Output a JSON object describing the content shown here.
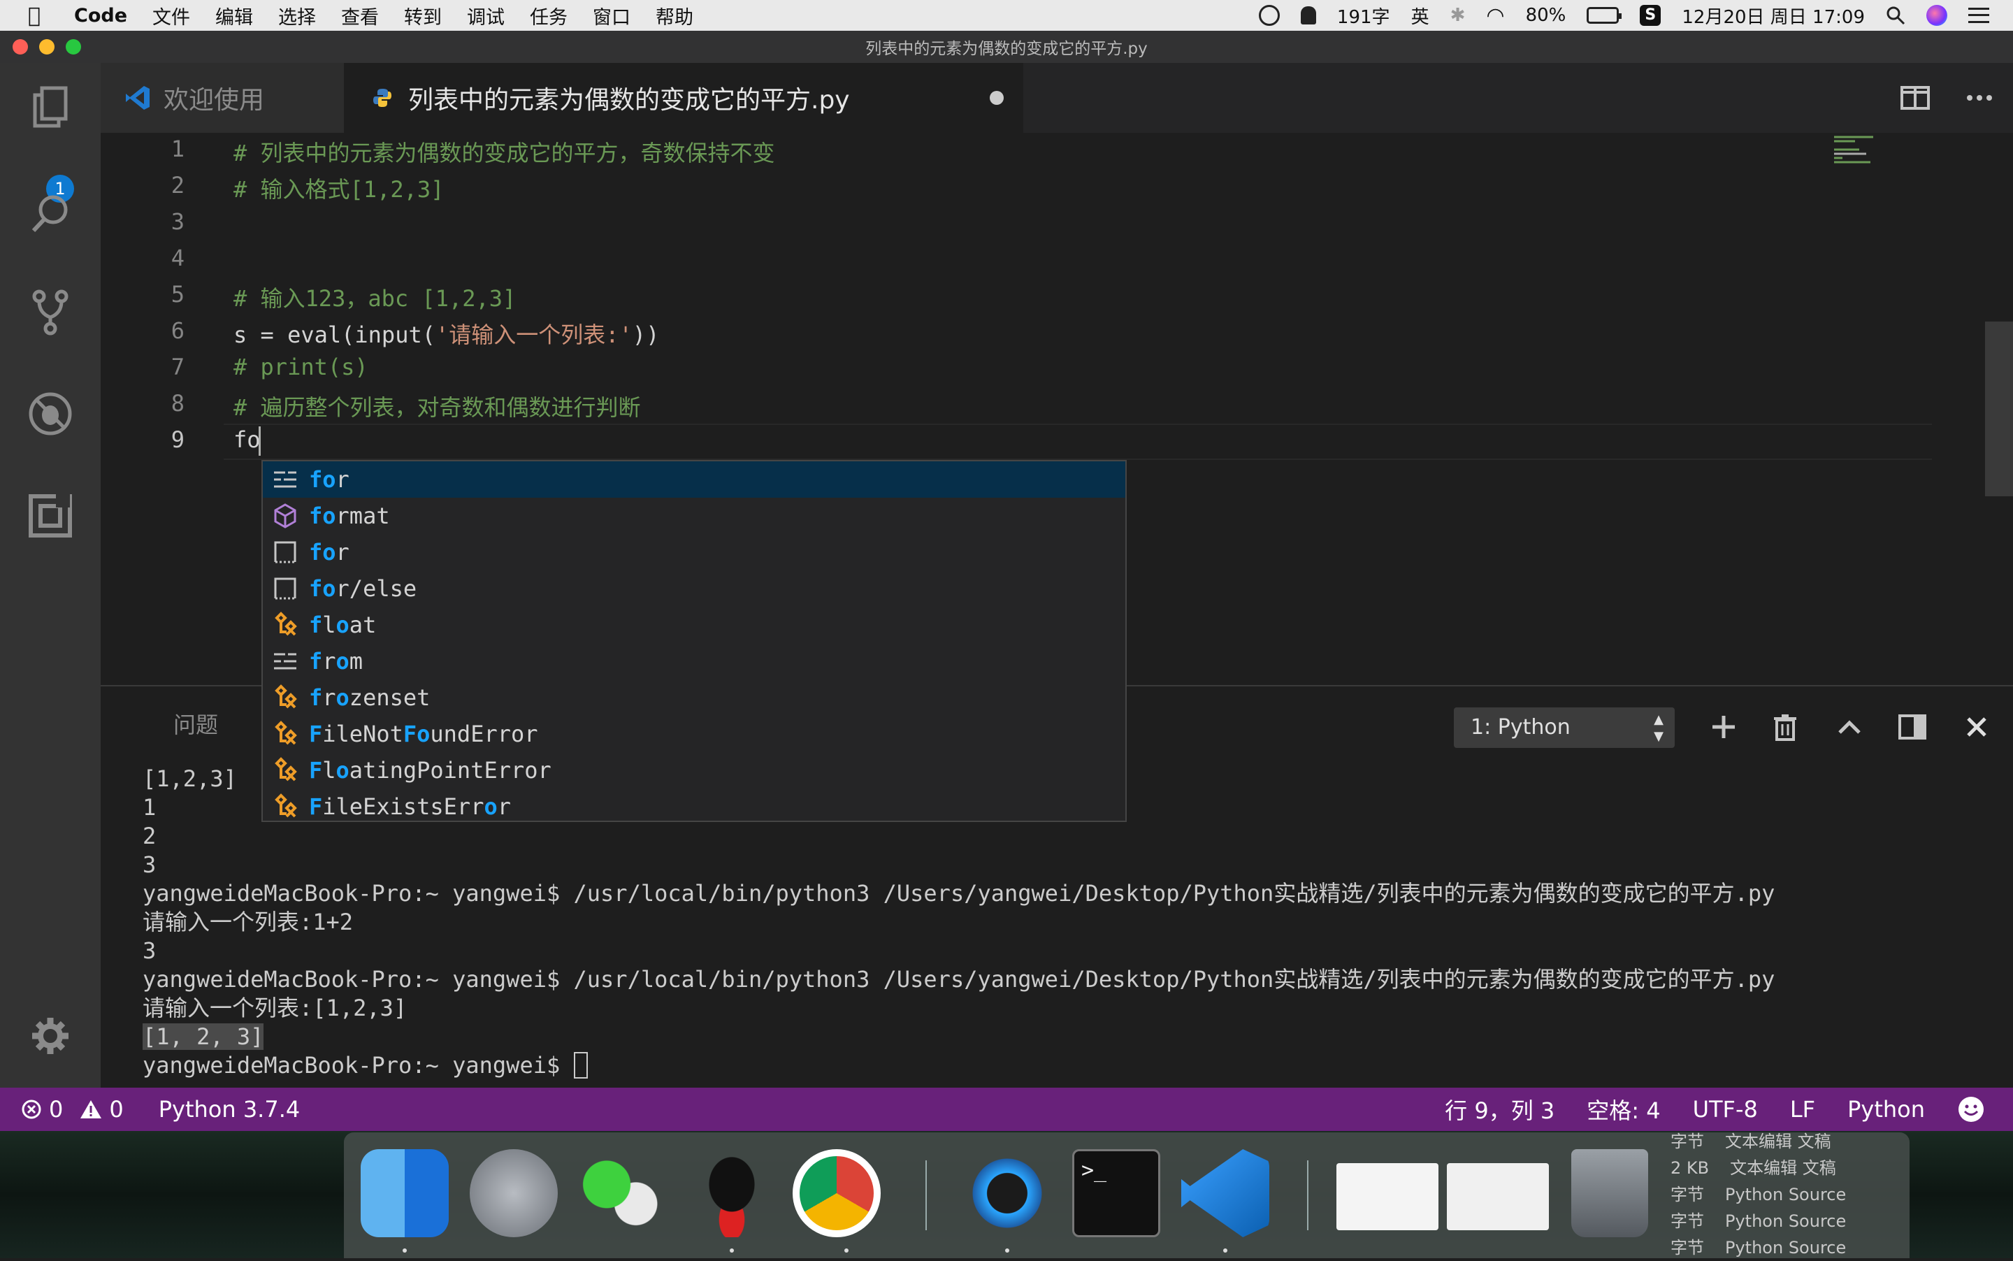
{
  "menubar": {
    "app": "Code",
    "items": [
      "文件",
      "编辑",
      "选择",
      "查看",
      "转到",
      "调试",
      "任务",
      "窗口",
      "帮助"
    ],
    "word_count": "191字",
    "ime": "英",
    "battery": "80%",
    "datetime": "12月20日 周日  17:09"
  },
  "window": {
    "title": "列表中的元素为偶数的变成它的平方.py"
  },
  "activity": {
    "explorer_badge": "1"
  },
  "tabs": [
    {
      "label": "欢迎使用"
    },
    {
      "label": "列表中的元素为偶数的变成它的平方.py"
    }
  ],
  "editor": {
    "line_numbers": [
      "1",
      "2",
      "3",
      "4",
      "5",
      "6",
      "7",
      "8",
      "9"
    ],
    "lines": {
      "l1": "# 列表中的元素为偶数的变成它的平方，奇数保持不变",
      "l2": "# 输入格式[1,2,3]",
      "l5": "# 输入123，abc [1,2,3]",
      "l6_pre": "s = eval(input(",
      "l6_str": "'请输入一个列表:'",
      "l6_post": "))",
      "l7": "# print(s)",
      "l8": "# 遍历整个列表，对奇数和偶数进行判断",
      "l9": "fo"
    }
  },
  "suggest": [
    {
      "hl": "fo",
      "rest": "r",
      "icon": "keyword-icon"
    },
    {
      "hl": "fo",
      "rest": "rmat",
      "icon": "module-icon"
    },
    {
      "hl": "fo",
      "rest": "r",
      "icon": "snippet-icon"
    },
    {
      "hl": "fo",
      "rest": "r/else",
      "icon": "snippet-icon"
    },
    {
      "pre": "",
      "hl": "f",
      "mid": "l",
      "hl2": "o",
      "rest": "at",
      "icon": "class-icon"
    },
    {
      "hl": "f",
      "mid": "r",
      "hl2": "o",
      "rest": "m",
      "icon": "keyword-icon"
    },
    {
      "hl": "f",
      "mid": "r",
      "hl2": "o",
      "rest": "zenset",
      "icon": "class-icon"
    },
    {
      "hl": "F",
      "mid": "ileNot",
      "hl2": "Fo",
      "rest": "undError",
      "icon": "class-icon"
    },
    {
      "hl": "F",
      "mid": "l",
      "hl2": "o",
      "rest": "atingPointError",
      "icon": "class-icon"
    },
    {
      "hl": "F",
      "mid": "ileExistsErr",
      "hl2": "o",
      "rest": "r",
      "icon": "class-icon"
    }
  ],
  "panel": {
    "tab_problems": "问题",
    "terminal_select": "1: Python",
    "terminal": {
      "t1": "[1,2,3]",
      "t2": "1",
      "t3": "2",
      "t4": "3",
      "t5": "yangweideMacBook-Pro:~ yangwei$ /usr/local/bin/python3 /Users/yangwei/Desktop/Python实战精选/列表中的元素为偶数的变成它的平方.py",
      "t6": "请输入一个列表:1+2",
      "t7": "3",
      "t8": "yangweideMacBook-Pro:~ yangwei$ /usr/local/bin/python3 /Users/yangwei/Desktop/Python实战精选/列表中的元素为偶数的变成它的平方.py",
      "t9": "请输入一个列表:[1,2,3]",
      "t10": "[1, 2, 3]",
      "t11": "yangweideMacBook-Pro:~ yangwei$ "
    }
  },
  "status": {
    "errors": "0",
    "warnings": "0",
    "interpreter": "Python 3.7.4",
    "position": "行 9，列 3",
    "spaces": "空格: 4",
    "encoding": "UTF-8",
    "eol": "LF",
    "language": "Python"
  },
  "stack_list": [
    {
      "size": "字节",
      "kind": "文本编辑 文稿"
    },
    {
      "size": "2 KB",
      "kind": "文本编辑 文稿"
    },
    {
      "size": "字节",
      "kind": "Python Source"
    },
    {
      "size": "字节",
      "kind": "Python Source"
    },
    {
      "size": "字节",
      "kind": "Python Source"
    }
  ],
  "colors": {
    "status_bar": "#68217a",
    "accent": "#0e7ad1",
    "comment": "#6a9955",
    "string": "#ce9178",
    "match": "#18a3ff"
  }
}
